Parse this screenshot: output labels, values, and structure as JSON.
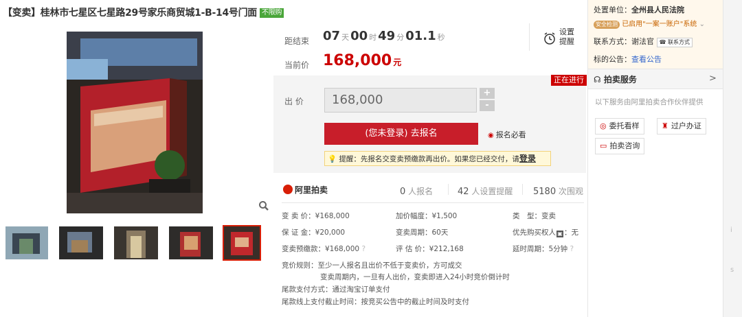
{
  "title": {
    "text": "【变卖】桂林市七星区七星路29号家乐商贸城1-B-14号门面",
    "tag": "不限购"
  },
  "countdown": {
    "label": "距结束",
    "days": "07",
    "days_unit": "天",
    "hours": "00",
    "hours_unit": "时",
    "minutes": "49",
    "minutes_unit": "分",
    "seconds": "01.1",
    "seconds_unit": "秒"
  },
  "remind": {
    "line1": "设置",
    "line2": "提醒"
  },
  "current_price": {
    "label": "当前价",
    "value": "168,000",
    "unit": "元"
  },
  "status_badge": "正在进行",
  "bid": {
    "label": "出 价",
    "value": "168,000",
    "plus": "+",
    "minus": "-"
  },
  "signup": {
    "button": "(您未登录) 去报名",
    "must_read": "报名必看"
  },
  "notice": {
    "text": "提醒：先报名交变卖预缴款再出价。如果您已经交付，请",
    "link": "登录"
  },
  "platform": {
    "name": "阿里拍卖"
  },
  "stats": {
    "signups": "0",
    "signups_label": "人报名",
    "reminders": "42",
    "reminders_label": "人设置提醒",
    "views": "5180",
    "views_label": "次围观"
  },
  "details": {
    "sell_price": "变 卖 价：¥168,000",
    "increment": "加价幅度：¥1,500",
    "type": "类　型：变卖",
    "deposit": "保 证 金：¥20,000",
    "period": "变卖周期：60天",
    "priority": "优先购买权人",
    "priority_value": "：无",
    "prepay": "变卖预缴款：¥168,000",
    "estimate": "评 估 价：¥212,168",
    "delay": "延时周期：5分钟"
  },
  "rules": {
    "line1": "竞价规则：至少一人报名且出价不低于变卖价，方可成交",
    "line2": "变卖周期内，一旦有人出价，变卖即进入24小时竞价倒计时",
    "line3": "尾款支付方式：通过淘宝订单支付",
    "line4": "尾款线上支付截止时间：按竞买公告中的截止时间及时支付"
  },
  "sidebar": {
    "unit_label": "处置单位：",
    "unit_value": "全州县人民法院",
    "security_badge": "安全检测",
    "security_text": "已启用\"一案一账户\"系统",
    "contact_label": "联系方式：",
    "contact_value": "谢法官",
    "contact_button": "联系方式",
    "notice_label": "标的公告：",
    "notice_link": "查看公告",
    "service_title": "拍卖服务",
    "service_chevron": ">",
    "service_desc": "以下服务由阿里拍卖合作伙伴提供",
    "svc1": "委托看样",
    "svc2": "过户办证",
    "svc3": "拍卖咨询"
  },
  "scroll_text": {
    "a": "i",
    "b": "s"
  },
  "colors": {
    "accent": "#c81e2a",
    "price": "#cc0000",
    "tag": "#4aa63a"
  }
}
